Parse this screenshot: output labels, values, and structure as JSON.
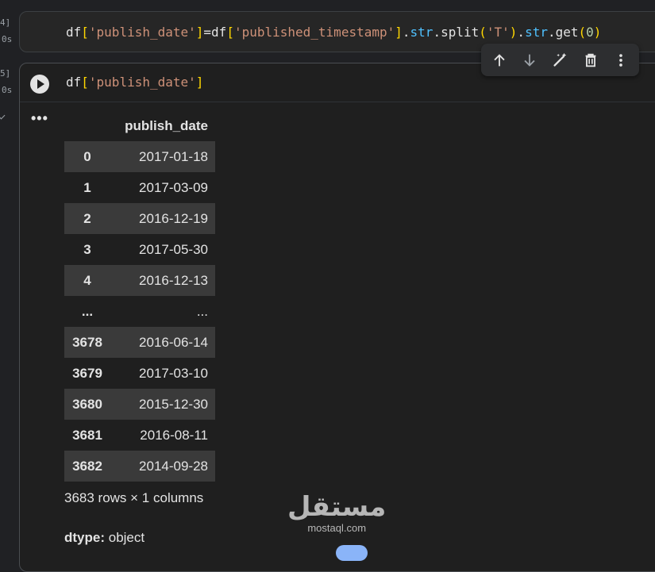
{
  "gutter": {
    "prev_exec_count": "4]",
    "prev_exec_time": "0s",
    "cur_exec_count": "5]",
    "cur_exec_time": "0s"
  },
  "prev_cell": {
    "code_tokens": [
      "df",
      "[",
      "'publish_date'",
      "]",
      "=df",
      "[",
      "'published_timestamp'",
      "]",
      ".",
      "str",
      ".split",
      "(",
      "'T'",
      ")",
      ".",
      "str",
      ".get",
      "(",
      "0",
      ")"
    ]
  },
  "current_cell": {
    "code_tokens": [
      "df",
      "[",
      "'publish_date'",
      "]"
    ]
  },
  "toolbar": {
    "icons": [
      "arrow-up-icon",
      "arrow-down-icon",
      "edit-sparkle-icon",
      "delete-icon",
      "more-vert-icon"
    ]
  },
  "output": {
    "menu_glyph": "•••",
    "column_header": "publish_date",
    "rows": [
      {
        "index": "0",
        "value": "2017-01-18"
      },
      {
        "index": "1",
        "value": "2017-03-09"
      },
      {
        "index": "2",
        "value": "2016-12-19"
      },
      {
        "index": "3",
        "value": "2017-05-30"
      },
      {
        "index": "4",
        "value": "2016-12-13"
      },
      {
        "index": "...",
        "value": "..."
      },
      {
        "index": "3678",
        "value": "2016-06-14"
      },
      {
        "index": "3679",
        "value": "2017-03-10"
      },
      {
        "index": "3680",
        "value": "2015-12-30"
      },
      {
        "index": "3681",
        "value": "2016-08-11"
      },
      {
        "index": "3682",
        "value": "2014-09-28"
      }
    ],
    "summary": "3683 rows × 1 columns",
    "dtype_label": "dtype:",
    "dtype_value": "object"
  },
  "watermark": {
    "logo_text": "مستقل",
    "url": "mostaql.com"
  }
}
